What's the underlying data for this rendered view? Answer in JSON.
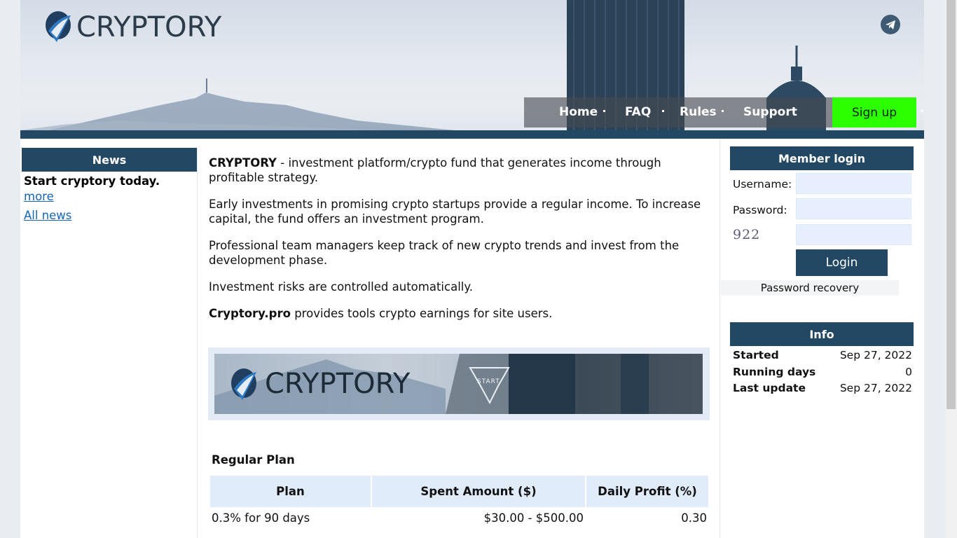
{
  "brand": {
    "logo_text": "CRYPTORY"
  },
  "nav": {
    "home": "Home",
    "faq": "FAQ",
    "rules": "Rules",
    "support": "Support",
    "signup": "Sign up"
  },
  "news": {
    "header": "News",
    "title": "Start cryptory today.",
    "more": "more",
    "all": "All news"
  },
  "intro": {
    "p1_bold": "CRYPTORY",
    "p1_rest": " - investment platform/crypto fund that generates income through profitable strategy.",
    "p2": "Early investments in promising crypto startups provide a regular income. To increase capital, the fund offers an investment program.",
    "p3": "Professional team managers keep track of new crypto trends and invest from the development phase.",
    "p4": "Investment risks are controlled automatically.",
    "p5_bold": "Cryptory.pro",
    "p5_rest": " provides tools crypto earnings for site users."
  },
  "banner": {
    "logo_text": "CRYPTORY",
    "start_label": "START"
  },
  "plan": {
    "title": "Regular Plan",
    "columns": [
      "Plan",
      "Spent Amount ($)",
      "Daily Profit (%)"
    ],
    "rows": [
      {
        "plan": "0.3% for 90 days",
        "amount": "$30.00 - $500.00",
        "profit": "0.30"
      }
    ]
  },
  "login": {
    "header": "Member login",
    "username_label": "Username:",
    "password_label": "Password:",
    "captcha": "922",
    "button": "Login",
    "recovery": "Password recovery"
  },
  "info": {
    "header": "Info",
    "rows": [
      {
        "key": "Started",
        "value": "Sep 27, 2022"
      },
      {
        "key": "Running days",
        "value": "0"
      },
      {
        "key": "Last update",
        "value": "Sep 27, 2022"
      }
    ]
  },
  "colors": {
    "primary": "#234863",
    "signup": "#2bff00",
    "link": "#1565b8",
    "input_bg": "#e7efff"
  }
}
